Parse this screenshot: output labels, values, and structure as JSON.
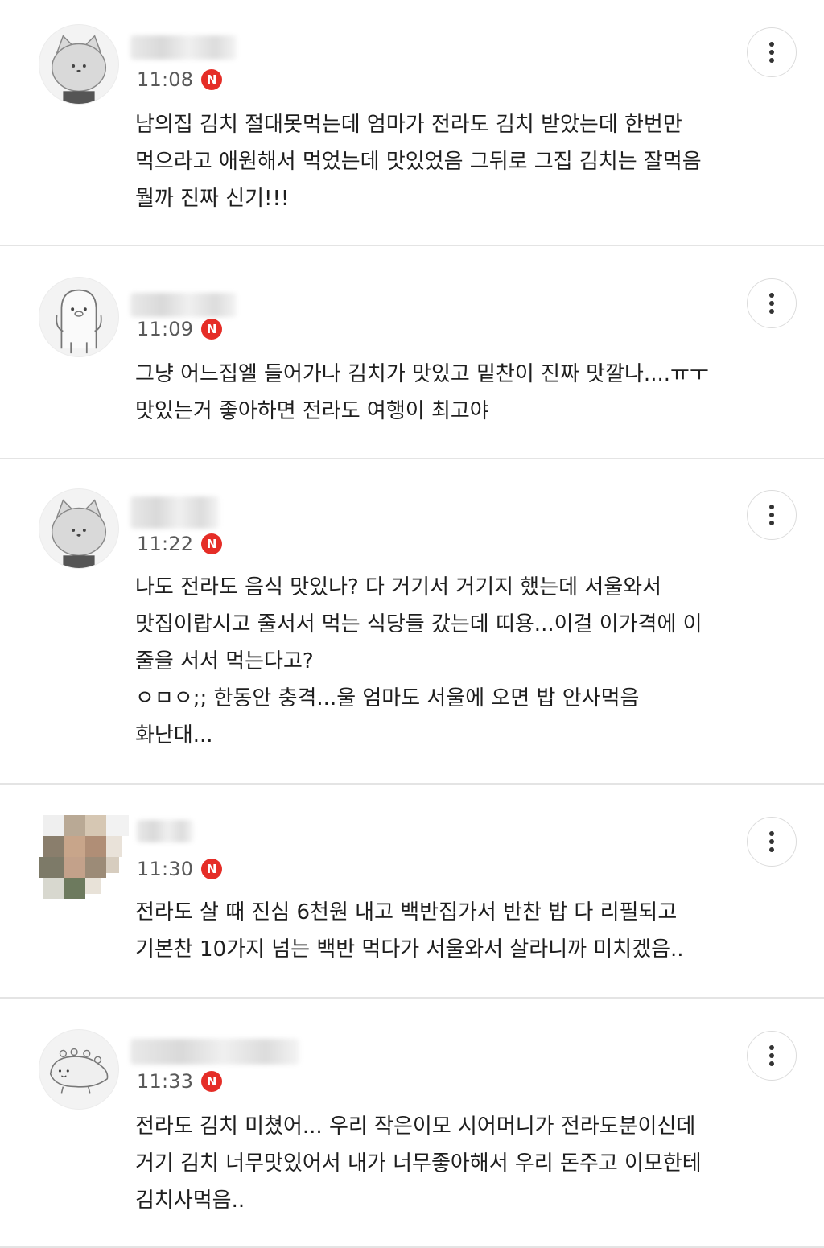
{
  "comments": [
    {
      "time": "11:08",
      "badge": "N",
      "avatar": "cat-avatar",
      "lines": [
        "남의집 김치 절대못먹는데 엄마가 전라도 김치 받았는데 한번만",
        "먹으라고 애원해서 먹었는데 맛있었음 그뒤로 그집 김치는 잘먹음",
        "뭘까 진짜 신기!!!"
      ]
    },
    {
      "time": "11:09",
      "badge": "N",
      "avatar": "ghost-avatar",
      "lines": [
        "그냥 어느집엘 들어가나 김치가 맛있고 밑찬이 진짜 맛깔나....ㅠㅜ",
        "맛있는거 좋아하면 전라도 여행이 최고야"
      ]
    },
    {
      "time": "11:22",
      "badge": "N",
      "avatar": "cat-avatar",
      "lines": [
        "나도 전라도 음식 맛있나? 다 거기서 거기지 했는데 서울와서",
        "맛집이랍시고 줄서서 먹는 식당들 갔는데 띠용...이걸 이가격에 이",
        "줄을 서서 먹는다고?",
        "ㅇㅁㅇ;; 한동안 충격...울 엄마도 서울에 오면 밥 안사먹음",
        "화난대..."
      ]
    },
    {
      "time": "11:30",
      "badge": "N",
      "avatar": "pixelated-photo-avatar",
      "lines": [
        "전라도 살 때 진심 6천원 내고 백반집가서 반찬 밥 다 리필되고",
        "기본찬 10가지 넘는 백반 먹다가 서울와서 살라니까 미치겠음.."
      ]
    },
    {
      "time": "11:33",
      "badge": "N",
      "avatar": "lizard-avatar",
      "lines": [
        "전라도 김치 미쳤어... 우리 작은이모 시어머니가 전라도분이신데",
        "거기 김치 너무맛있어서 내가 너무좋아해서 우리 돈주고 이모한테",
        "김치사먹음.."
      ]
    }
  ],
  "colors": {
    "badge": "#e52d27",
    "divider": "#e4e4e4",
    "time": "#5a5a5a",
    "text": "#1e1e1e"
  }
}
